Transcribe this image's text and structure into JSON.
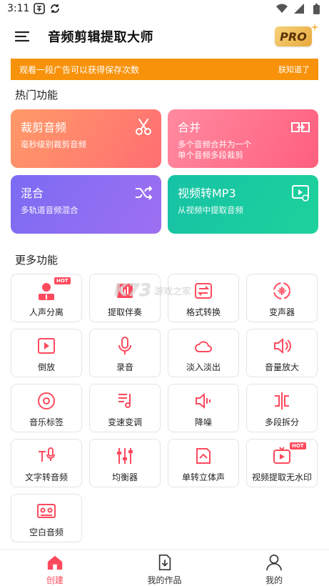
{
  "status_bar": {
    "time": "3:11",
    "icons": [
      "app-badge-icon",
      "sync-icon",
      "wifi-icon",
      "signal-icon",
      "battery-icon"
    ]
  },
  "app_bar": {
    "title": "音频剪辑提取大师",
    "pro_label": "PRO",
    "menu_icon": "menu-icon"
  },
  "notice": {
    "text": "观看一段广告可以获得保存次数",
    "dismiss": "朕知道了"
  },
  "hot_section": {
    "title": "热门功能",
    "cards": [
      {
        "title": "裁剪音频",
        "desc": "毫秒级别裁剪音频",
        "icon": "scissors-icon",
        "color": "#ff7b6b"
      },
      {
        "title": "合并",
        "desc": "多个音频合并为一个\n单个音频多段裁剪",
        "icon": "merge-icon",
        "color": "#ff6f8f"
      },
      {
        "title": "混合",
        "desc": "多轨道音频混合",
        "icon": "shuffle-icon",
        "color": "#8a6cf3"
      },
      {
        "title": "视频转MP3",
        "desc": "从视频中提取音频",
        "icon": "video-to-audio-icon",
        "color": "#1dc8a0"
      }
    ]
  },
  "more_section": {
    "title": "更多功能",
    "hot_badge": "HOT",
    "tiles": [
      {
        "label": "人声分离",
        "icon": "vocal-separate-icon",
        "hot": true
      },
      {
        "label": "提取伴奏",
        "icon": "extract-accompaniment-icon",
        "hot": false
      },
      {
        "label": "格式转换",
        "icon": "format-convert-icon",
        "hot": false
      },
      {
        "label": "变声器",
        "icon": "voice-changer-icon",
        "hot": false
      },
      {
        "label": "倒放",
        "icon": "reverse-play-icon",
        "hot": false
      },
      {
        "label": "录音",
        "icon": "microphone-icon",
        "hot": false
      },
      {
        "label": "淡入淡出",
        "icon": "cloud-icon",
        "hot": false
      },
      {
        "label": "音量放大",
        "icon": "volume-up-icon",
        "hot": false
      },
      {
        "label": "音乐标签",
        "icon": "music-disc-icon",
        "hot": false
      },
      {
        "label": "变速变调",
        "icon": "music-note-icon",
        "hot": false
      },
      {
        "label": "降噪",
        "icon": "noise-reduce-icon",
        "hot": false
      },
      {
        "label": "多段拆分",
        "icon": "split-icon",
        "hot": false
      },
      {
        "label": "文字转音频",
        "icon": "text-to-speech-icon",
        "hot": false
      },
      {
        "label": "均衡器",
        "icon": "equalizer-icon",
        "hot": false
      },
      {
        "label": "单转立体声",
        "icon": "mono-to-stereo-icon",
        "hot": false
      },
      {
        "label": "视频提取无水印",
        "icon": "video-extract-icon",
        "hot": true
      },
      {
        "label": "空白音频",
        "icon": "cassette-icon",
        "hot": false
      }
    ]
  },
  "watermark": {
    "logo": "K73",
    "text": "游戏之家"
  },
  "bottom_nav": [
    {
      "label": "创建",
      "icon": "home-icon",
      "active": true
    },
    {
      "label": "我的作品",
      "icon": "download-file-icon",
      "active": false
    },
    {
      "label": "我的",
      "icon": "user-icon",
      "active": false
    }
  ],
  "colors": {
    "accent": "#ff4a5d",
    "notice": "#f7920a"
  }
}
